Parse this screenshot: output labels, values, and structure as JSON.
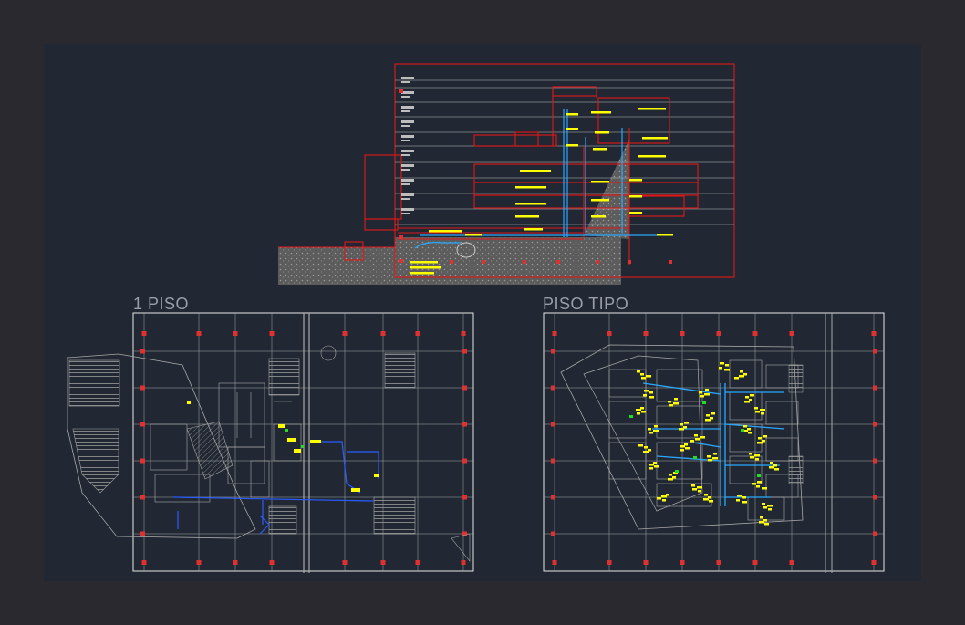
{
  "drawing": {
    "background": "#2b2930",
    "canvas_color": "#212833"
  },
  "section_view": {
    "frame_color": "#e01818",
    "pipe_color": "#2aa8ff",
    "note_color": "#ffff00",
    "ground_color": "#7a7a7a"
  },
  "plans": [
    {
      "title": "1 PISO",
      "frame_color": "#e6e6e6",
      "pipe_color": "#2a5cff"
    },
    {
      "title": "PISO TIPO",
      "frame_color": "#e6e6e6",
      "pipe_color": "#2aa8ff",
      "fixture_color": "#ffff00",
      "valve_color": "#22dd22"
    }
  ],
  "colors": {
    "linework": "#a8a8a8",
    "column_marker": "#e03030",
    "hatch": "#8a8a8a"
  }
}
